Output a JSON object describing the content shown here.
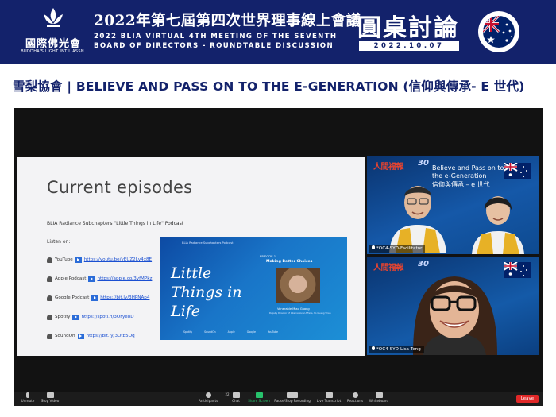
{
  "banner": {
    "logo_text": "國際佛光會",
    "logo_sub": "BUDDHA'S LIGHT INT'L ASSN.",
    "title_zh": "2022年第七屆第四次世界理事線上會議",
    "title_en_line1": "2022 BLIA VIRTUAL 4TH MEETING OF THE SEVENTH",
    "title_en_line2": "BOARD OF DIRECTORS - ROUNDTABLE DISCUSSION",
    "roundtable_zh": "圓桌討論",
    "date": "2022.10.07",
    "flag_icon": "australia-flag-icon"
  },
  "heading": "雪梨協會 | BELIEVE AND PASS ON TO THE E-GENERATION (信仰與傳承- E 世代)",
  "shared_slide": {
    "title": "Current episodes",
    "podcast_line": "BLIA Radiance Subchapters \"Little Things in Life\" Podcast",
    "listen_label": "Listen on:",
    "platforms": [
      {
        "name": "YouTube",
        "url": "https://youtu.be/yEUZ2Lv4x8E"
      },
      {
        "name": "Apple Podcast",
        "url": "https://apple.co/3vfMPkz"
      },
      {
        "name": "Google Podcast",
        "url": "https://bit.ly/3HPNAp4"
      },
      {
        "name": "Spotify",
        "url": "https://spoti.fi/3OFye8D"
      },
      {
        "name": "SoundOn",
        "url": "https://bit.ly/3Otb5Oq"
      }
    ],
    "cover": {
      "brand": "BLIA Radiance Subchapters Podcast",
      "title": "Little Things in Life",
      "episode": "EPISODE 1",
      "episode_title": "Making Better Choices",
      "speaker": "Venerable Miao Guang",
      "speaker_desc": "Deputy Director of International Affairs, Fo Guang Shan",
      "platform_logos": "Spotify SoundOn Apple Google YouTube"
    }
  },
  "video_tiles": [
    {
      "logo": "人間福報",
      "background_line1": "Believe and Pass on to the e-Generation",
      "background_line2": "信仰與傳承 – e 世代",
      "name": "*OC4-SYD-Facilitator"
    },
    {
      "logo": "人間福報",
      "name": "*OC4-SYD-Lisa Teng"
    }
  ],
  "toolbar": {
    "unmute": "Unmute",
    "stop_video": "Stop Video",
    "participants": "Participants",
    "participants_count": "22",
    "chat": "Chat",
    "share_screen": "Share Screen",
    "pause_recording": "Pause/Stop Recording",
    "live_transcript": "Live Transcript",
    "reactions": "Reactions",
    "whiteboard": "Whiteboard",
    "leave": "Leave"
  }
}
